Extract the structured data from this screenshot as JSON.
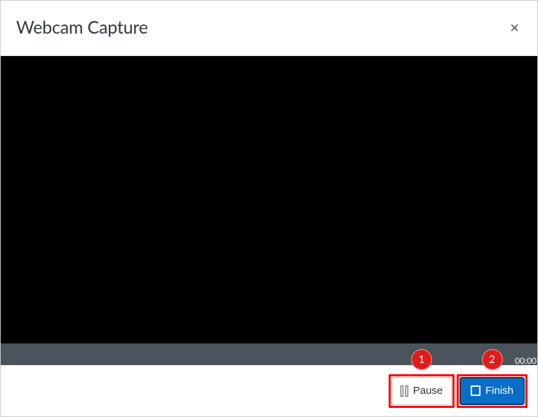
{
  "header": {
    "title": "Webcam Capture",
    "close_label": "×"
  },
  "progress": {
    "timer": "00:00"
  },
  "callouts": {
    "pause": "1",
    "finish": "2"
  },
  "buttons": {
    "pause": "Pause",
    "finish": "Finish"
  }
}
